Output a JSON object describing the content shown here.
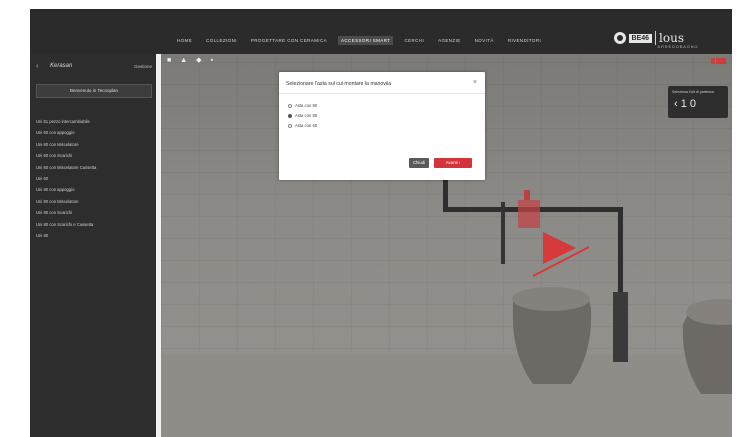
{
  "nav": {
    "items": [
      "Home",
      "Collezioni",
      "Progettare con ceramica",
      "Accessori smart",
      "Cerchi",
      "Agenzie",
      "Novità",
      "Rivenditori"
    ],
    "active_index": 3
  },
  "brand": {
    "boxed": "BE46",
    "word": "lous",
    "sub": "ARREDOBAGNO"
  },
  "sidebar": {
    "back_symbol": "‹",
    "script_brand": "Kerasan",
    "right_label": "Gestione",
    "welcome": "Benvenuto in Tecnoplan",
    "items": [
      "Uni 51 pezzo intercambiabile",
      "Uni 60 con appoggio",
      "Uni 60 con Miscelatore",
      "Uni 60 con Scarichi",
      "Uni 60 con Miscelatore Cassetta",
      "Uni 60",
      "Uni 80 con appoggio",
      "Uni 80 con Miscelatore",
      "Uni 80 con Scarichi",
      "Uni 80 con Scarichi e Cassetta",
      "Uni 80"
    ]
  },
  "viewport": {
    "toolbar": [
      "■",
      "▲",
      "◆",
      "▪"
    ],
    "view_panel_label": "Seleziona il kit di partenza",
    "view_panel_value": "‹ 1 0"
  },
  "dialog": {
    "title": "Selezionare l'asta sul cui montare la manoviia",
    "close_symbol": "×",
    "options": [
      "Asta con 90",
      "Asta con 80",
      "Asta con 60"
    ],
    "selected_index": 1,
    "btn_close": "Chiudi",
    "btn_next": "Avanti ›"
  },
  "colors": {
    "accent": "#d2343a",
    "panel": "#2d2d2e",
    "play": "#d63a3a"
  }
}
